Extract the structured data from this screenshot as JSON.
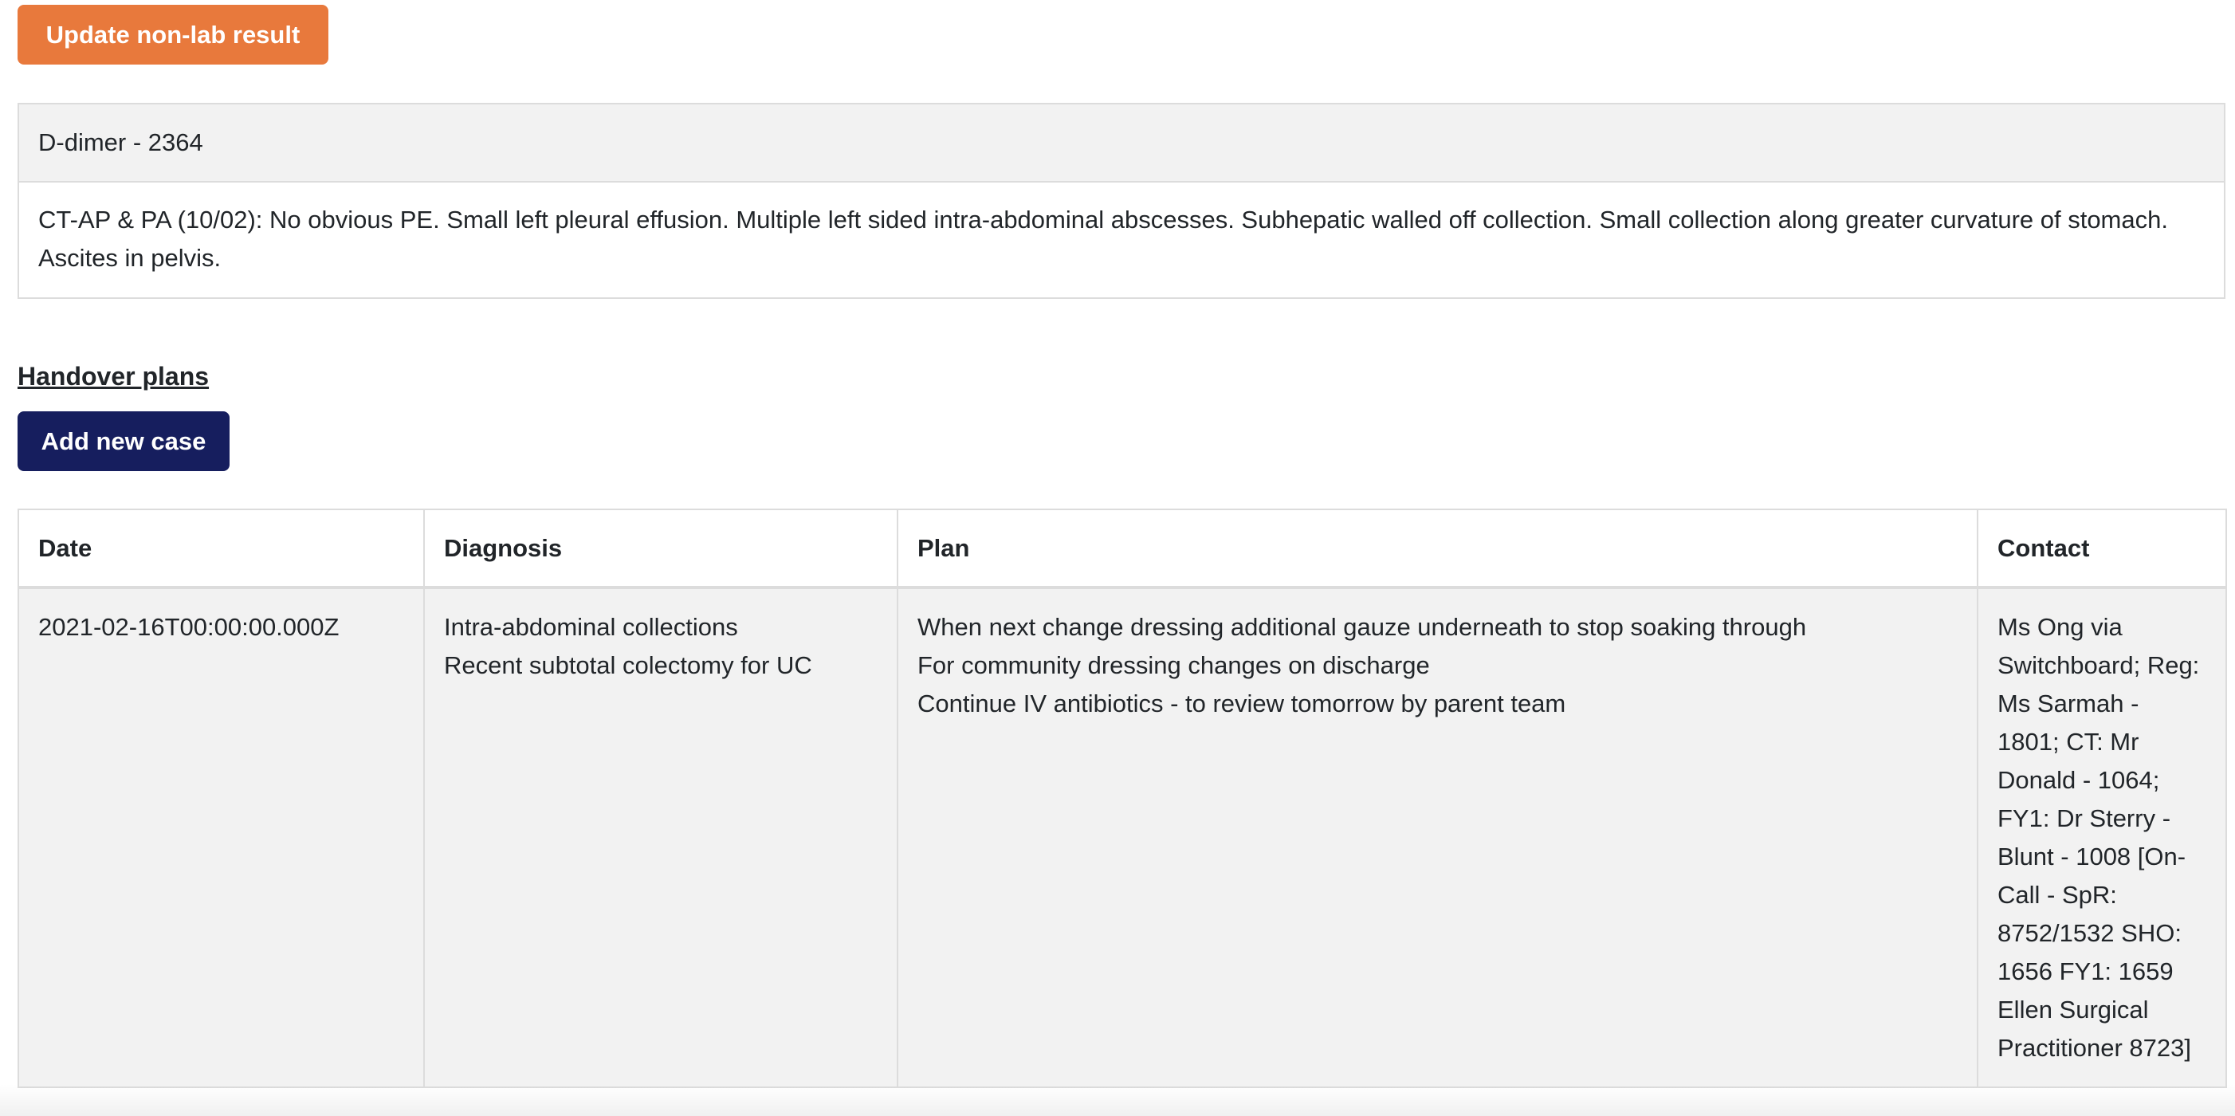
{
  "toolbar": {
    "update_label": "Update non-lab result"
  },
  "results": [
    "D-dimer - 2364",
    "CT-AP & PA (10/02): No obvious PE. Small left pleural effusion. Multiple left sided intra-abdominal abscesses. Subhepatic walled off collection. Small collection along greater curvature of stomach. Ascites in pelvis."
  ],
  "handover": {
    "title": "Handover plans",
    "add_label": "Add new case",
    "columns": [
      "Date",
      "Diagnosis",
      "Plan",
      "Contact"
    ],
    "rows": [
      {
        "date": "2021-02-16T00:00:00.000Z",
        "diagnosis": [
          "Intra-abdominal collections",
          "Recent subtotal colectomy for UC"
        ],
        "plan": [
          "When next change dressing additional gauze underneath to stop soaking through",
          "For community dressing changes on discharge",
          "Continue IV antibiotics - to review tomorrow by parent team"
        ],
        "contact": "Ms Ong via Switchboard; Reg: Ms Sarmah - 1801;  CT: Mr Donald - 1064; FY1: Dr Sterry - Blunt - 1008 [On-Call - SpR: 8752/1532  SHO: 1656  FY1: 1659 Ellen Surgical Practitioner 8723]"
      }
    ]
  },
  "colors": {
    "update_button": "#e8793c",
    "add_button": "#161e5e",
    "row_background": "#f2f2f2",
    "border": "#dcdcdc"
  }
}
